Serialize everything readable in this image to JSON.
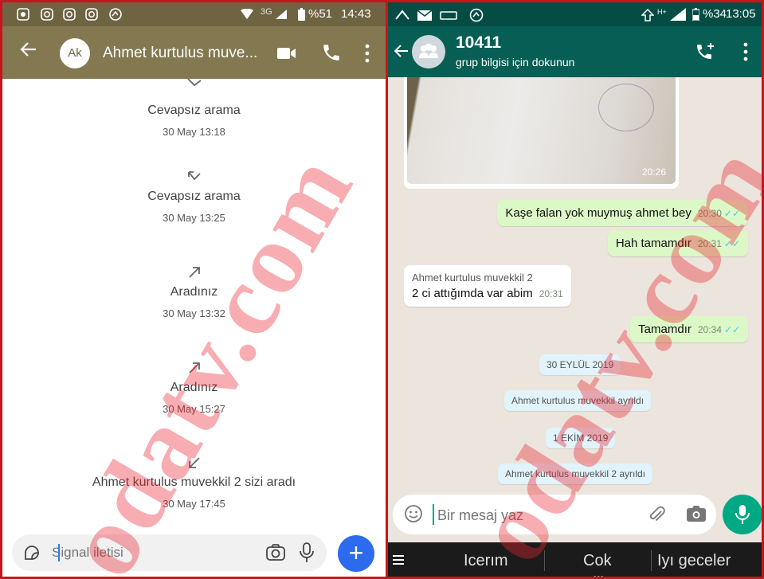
{
  "watermark": "odatv.com",
  "colors": {
    "frame": "#c8141c",
    "signal_appbar": "#837850",
    "signal_fab": "#2c6bed",
    "whatsapp_appbar": "#075e54",
    "outgoing_bubble": "#dcf8c6",
    "system_bubble": "#e1f3fb",
    "read_ticks": "#4fc3f7"
  },
  "signal": {
    "status": {
      "battery": "%51",
      "time": "14:43",
      "network": "3G"
    },
    "header": {
      "avatar_initials": "Ak",
      "title": "Ahmet kurtulus muve..."
    },
    "calls": [
      {
        "direction": "incoming-missed",
        "label": "Cevapsız arama",
        "time": "30 May 13:18"
      },
      {
        "direction": "incoming-missed",
        "label": "Cevapsız arama",
        "time": "30 May 13:25"
      },
      {
        "direction": "outgoing",
        "label": "Aradınız",
        "time": "30 May 13:32"
      },
      {
        "direction": "outgoing",
        "label": "Aradınız",
        "time": "30 May 15:27"
      },
      {
        "direction": "incoming",
        "label": "Ahmet kurtulus muvekkil 2 sizi aradı",
        "time": "30 May 17:45"
      }
    ],
    "compose": {
      "placeholder": "Signal iletisi"
    }
  },
  "whatsapp": {
    "status": {
      "battery": "%34",
      "time": "13:05"
    },
    "header": {
      "title": "10411",
      "subtitle": "grup bilgisi için dokunun"
    },
    "image_message": {
      "time": "20:26"
    },
    "messages": [
      {
        "type": "out",
        "text": "Kaşe falan yok muymuş ahmet bey",
        "time": "20:30",
        "ticks": "✓✓"
      },
      {
        "type": "out",
        "text": "Hah tamamdır",
        "time": "20:31",
        "ticks": "✓✓"
      },
      {
        "type": "in",
        "sender": "Ahmet kurtulus muvekkil 2",
        "text": "2 ci attığımda var abim",
        "time": "20:31"
      },
      {
        "type": "out",
        "text": "Tamamdır",
        "time": "20:34",
        "ticks": "✓✓"
      }
    ],
    "system": [
      "30 EYLÜL 2019",
      "Ahmet kurtulus muvekkil ayrıldı",
      "1 EKİM 2019",
      "Ahmet kurtulus muvekkil 2 ayrıldı"
    ],
    "compose": {
      "placeholder": "Bir mesaj yaz"
    },
    "keyboard_suggestions": [
      "Icerım",
      "Cok",
      "Iyı geceler"
    ]
  }
}
